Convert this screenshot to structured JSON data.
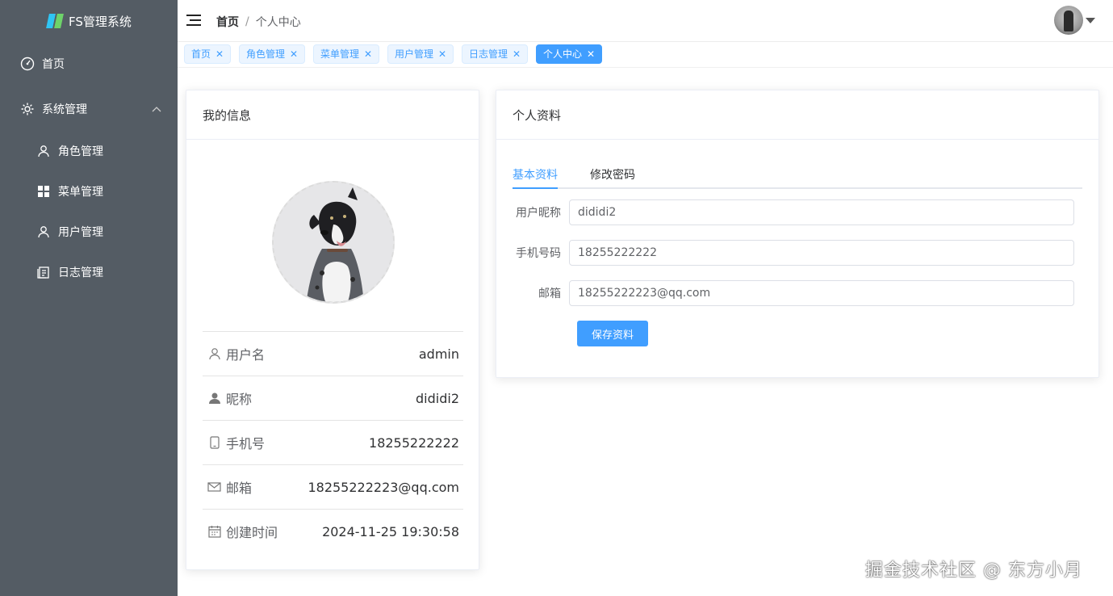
{
  "app": {
    "title": "FS管理系统"
  },
  "sidebar": {
    "items": [
      {
        "label": "首页",
        "icon": "dashboard-icon"
      },
      {
        "label": "系统管理",
        "icon": "gear-icon",
        "expanded": true
      },
      {
        "label": "角色管理",
        "icon": "user-icon"
      },
      {
        "label": "菜单管理",
        "icon": "grid-icon"
      },
      {
        "label": "用户管理",
        "icon": "user-icon"
      },
      {
        "label": "日志管理",
        "icon": "document-icon"
      }
    ]
  },
  "header": {
    "breadcrumb": [
      "首页",
      "/",
      "个人中心"
    ]
  },
  "tags": [
    {
      "label": "首页",
      "active": false
    },
    {
      "label": "角色管理",
      "active": false
    },
    {
      "label": "菜单管理",
      "active": false
    },
    {
      "label": "用户管理",
      "active": false
    },
    {
      "label": "日志管理",
      "active": false
    },
    {
      "label": "个人中心",
      "active": true
    }
  ],
  "my_info": {
    "title": "我的信息",
    "rows": [
      {
        "label": "用户名",
        "value": "admin",
        "icon": "user-outline-icon"
      },
      {
        "label": "昵称",
        "value": "dididi2",
        "icon": "user-solid-icon"
      },
      {
        "label": "手机号",
        "value": "18255222222",
        "icon": "phone-icon"
      },
      {
        "label": "邮箱",
        "value": "18255222223@qq.com",
        "icon": "mail-icon"
      },
      {
        "label": "创建时间",
        "value": "2024-11-25 19:30:58",
        "icon": "calendar-icon"
      }
    ]
  },
  "profile": {
    "title": "个人资料",
    "tabs": [
      "基本资料",
      "修改密码"
    ],
    "fields": [
      {
        "label": "用户昵称",
        "value": "dididi2"
      },
      {
        "label": "手机号码",
        "value": "18255222222"
      },
      {
        "label": "邮箱",
        "value": "18255222223@qq.com"
      }
    ],
    "save_label": "保存资料"
  },
  "watermark": "掘金技术社区 @ 东方小月",
  "colors": {
    "sidebar": "#545c64",
    "accent": "#409eff"
  }
}
